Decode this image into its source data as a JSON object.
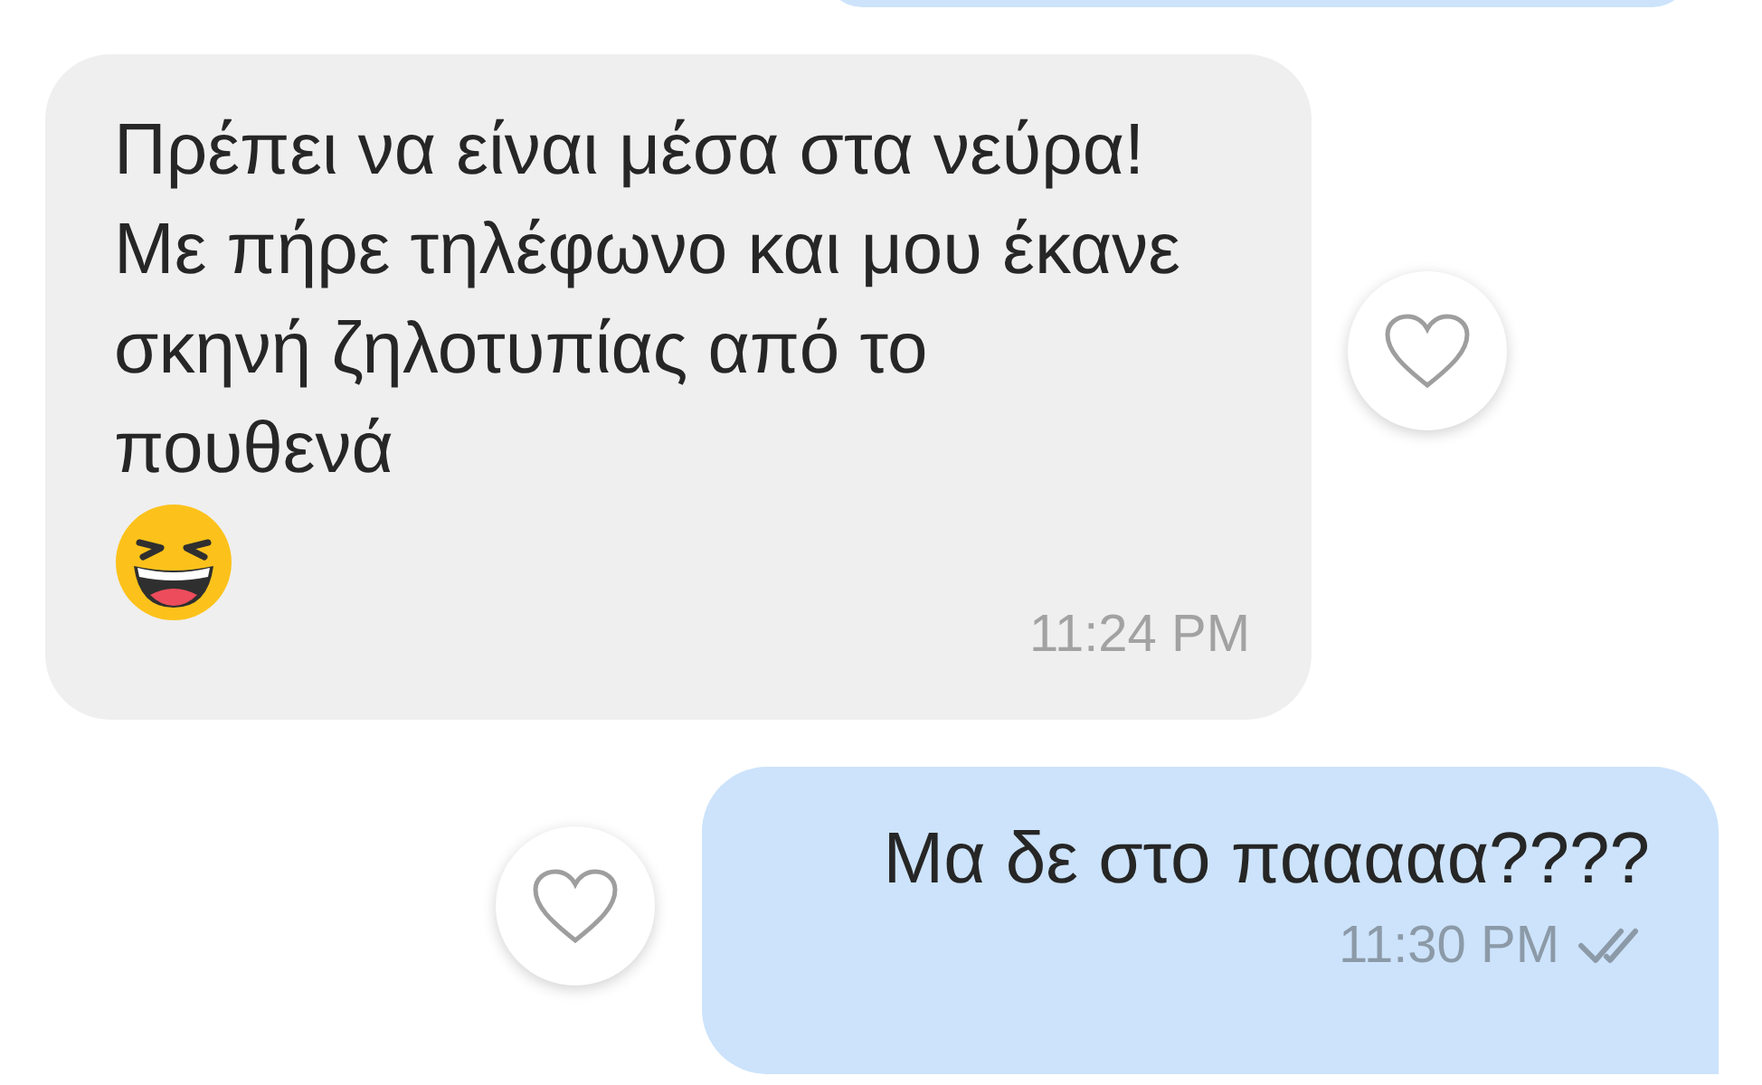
{
  "messages": [
    {
      "kind": "received",
      "text": "Πρέπει να είναι μέσα στα νεύρα! Με πήρε τηλέφωνο και μου έκανε σκηνή ζηλοτυπίας από το πουθενά",
      "emoji": {
        "kind": "laughing"
      },
      "time": "11:24 PM",
      "liked": false
    },
    {
      "kind": "sent",
      "text": "Μα δε στο πααααα????",
      "time": "11:30 PM",
      "receipt": {
        "kind": "read"
      },
      "liked": false
    }
  ]
}
